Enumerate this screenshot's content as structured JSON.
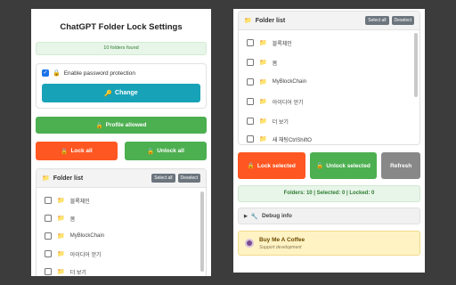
{
  "left": {
    "title": "ChatGPT Folder Lock Settings",
    "found_text": "10 folders found",
    "password_label": "Enable password protection",
    "change_label": "Change",
    "profile_label": "Profile allowed",
    "lock_all_label": "Lock all",
    "unlock_all_label": "Unlock all",
    "folder_list": {
      "title": "Folder list",
      "select_all": "Select all",
      "deselect": "Deselect",
      "items": [
        "블록체인",
        "봄",
        "MyBlockChain",
        "아이디어 얻기",
        "더 보기"
      ]
    }
  },
  "right": {
    "folder_list": {
      "title": "Folder list",
      "select_all": "Select all",
      "deselect": "Deselect",
      "items": [
        "블록체인",
        "봄",
        "MyBlockChain",
        "아이디어 얻기",
        "더 보기",
        "새 채팅CtrlShiftO"
      ]
    },
    "lock_selected_label": "Lock selected",
    "unlock_selected_label": "Unlock selected",
    "refresh_label": "Refresh",
    "stats_text": "Folders: 10 | Selected: 0 | Locked: 0",
    "debug_label": "Debug info",
    "coffee_title": "Buy Me A Coffee",
    "coffee_sub": "Support development"
  },
  "colors": {
    "accent_teal": "#17a2b8",
    "green": "#4caf50",
    "orange": "#ff5722",
    "grey_button": "#888888",
    "folder": "#f2b400"
  },
  "icons": {
    "lock": "lock-icon",
    "key": "key-icon",
    "unlock": "unlock-icon",
    "folder": "folder-icon",
    "checkbox_checked": "checkbox-checked-icon",
    "triangle": "triangle-right-icon",
    "wrench": "wrench-icon",
    "coffee": "coffee-icon"
  }
}
